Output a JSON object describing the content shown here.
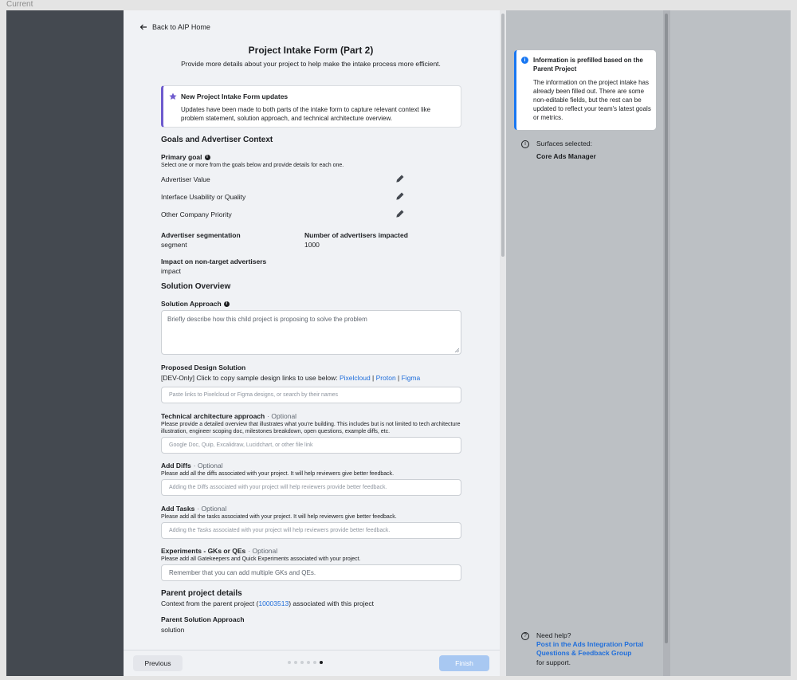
{
  "canvas_label": "Current",
  "form": {
    "back_link": "Back to AIP Home",
    "title": "Project Intake Form (Part 2)",
    "subtitle": "Provide more details about your project to help make the intake process more efficient.",
    "notice": {
      "title": "New Project Intake Form updates",
      "body": "Updates have been made to both parts of the intake form to capture relevant context like problem statement, solution approach, and technical architecture overview."
    },
    "goals_section": {
      "heading": "Goals and Advertiser Context",
      "primary_goal_label": "Primary goal",
      "primary_goal_help": "Select one or more from the goals below and provide details for each one.",
      "goals": [
        "Advertiser Value",
        "Interface Usability or Quality",
        "Other Company Priority"
      ],
      "segmentation_label": "Advertiser segmentation",
      "segmentation_value": "segment",
      "advertisers_impacted_label": "Number of advertisers impacted",
      "advertisers_impacted_value": "1000",
      "impact_label": "Impact on non-target advertisers",
      "impact_value": "impact"
    },
    "solution_section": {
      "heading": "Solution Overview",
      "approach_label": "Solution Approach",
      "approach_placeholder": "Briefly describe how this child project is proposing to solve the problem",
      "design_label": "Proposed Design Solution",
      "design_help_prefix": "[DEV-Only] Click to copy sample design links to use below: ",
      "design_links": [
        "Pixelcloud",
        "Proton",
        "Figma"
      ],
      "design_separator": " | ",
      "design_placeholder": "Paste links to Pixelcloud or Figma designs, or search by their names",
      "tech_label": "Technical architecture approach",
      "optional_suffix": "· Optional",
      "tech_help": "Please provide a detailed overview that illustrates what you're building. This includes but is not limited to tech architecture illustration, engineer scoping doc, milestones breakdown, open questions, example diffs, etc.",
      "tech_placeholder": "Google Doc, Quip, Excalidraw, Lucidchart, or other file link",
      "diffs_label": "Add Diffs",
      "diffs_help": "Please add all the diffs associated with your project. It will help reviewers give better feedback.",
      "diffs_placeholder": "Adding the Diffs associated with your project will help reviewers provide better feedback.",
      "tasks_label": "Add Tasks",
      "tasks_help": "Please add all the tasks associated with your project. It will help reviewers give better feedback.",
      "tasks_placeholder": "Adding the Tasks associated with your project will help reviewers provide better feedback.",
      "experiments_label": "Experiments - GKs or QEs",
      "experiments_help": "Please add all Gatekeepers and Quick Experiments associated with your project.",
      "experiments_placeholder": "Remember that you can add multiple GKs and QEs."
    },
    "parent_section": {
      "heading": "Parent project details",
      "context_prefix": "Context from the parent project (",
      "parent_id": "10003513",
      "context_suffix": ") associated with this project",
      "approach_label": "Parent Solution Approach",
      "approach_value": "solution"
    },
    "footer": {
      "previous": "Previous",
      "finish": "Finish",
      "steps_total": 6,
      "current_step": 6
    }
  },
  "side_panel": {
    "info_card": {
      "title": "Information is prefilled based on the Parent Project",
      "body": "The information on the project intake has already been filled out. There are some non-editable fields, but the rest can be updated to reflect your team's latest goals or metrics."
    },
    "surfaces_label": "Surfaces selected:",
    "surfaces_value": "Core Ads Manager",
    "help_label": "Need help?",
    "help_link": "Post in the Ads Integration Portal Questions & Feedback Group",
    "help_suffix": "for support."
  },
  "colors": {
    "accent": "#216fdb",
    "notice_border": "#6e5bce",
    "info_border": "#1877f2",
    "finish_disabled": "#a8c8f2"
  }
}
